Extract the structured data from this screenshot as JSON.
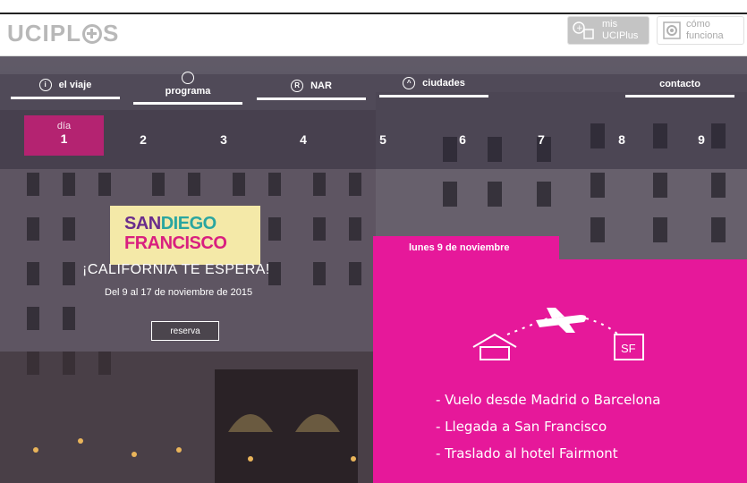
{
  "header": {
    "logo": "UCIPLUS",
    "mis_uciplus": "mis UCIPlus",
    "como_funciona": "cómo funciona"
  },
  "nav": {
    "items": [
      {
        "label": "el viaje",
        "icon": "compass-icon"
      },
      {
        "label": "programa",
        "icon": "clock-icon"
      },
      {
        "label": "NAR",
        "icon": "registered-icon"
      },
      {
        "label": "ciudades",
        "icon": "location-icon"
      },
      {
        "label": "contacto",
        "icon": ""
      }
    ]
  },
  "days": {
    "selected_word": "día",
    "selected": "1",
    "others": [
      "2",
      "3",
      "4",
      "5",
      "6",
      "7",
      "8",
      "9"
    ]
  },
  "promo": {
    "logo_line1_a": "SAN",
    "logo_line1_b": "DIEGO",
    "logo_line2": "FRANCISCO",
    "tagline": "¡CALIFORNIA TE ESPERA!",
    "dates": "Del 9 al 17 de noviembre de 2015",
    "button": "reserva"
  },
  "panel": {
    "date": "lunes 9 de noviembre",
    "destination_badge": "SF",
    "items": [
      "- Vuelo desde Madrid o Barcelona",
      "- Llegada a San Francisco",
      "- Traslado al hotel Fairmont"
    ]
  },
  "colors": {
    "accent_pink": "#e6189a",
    "logo_yellow": "#f4e9a8",
    "purple": "#6a2d8c"
  }
}
